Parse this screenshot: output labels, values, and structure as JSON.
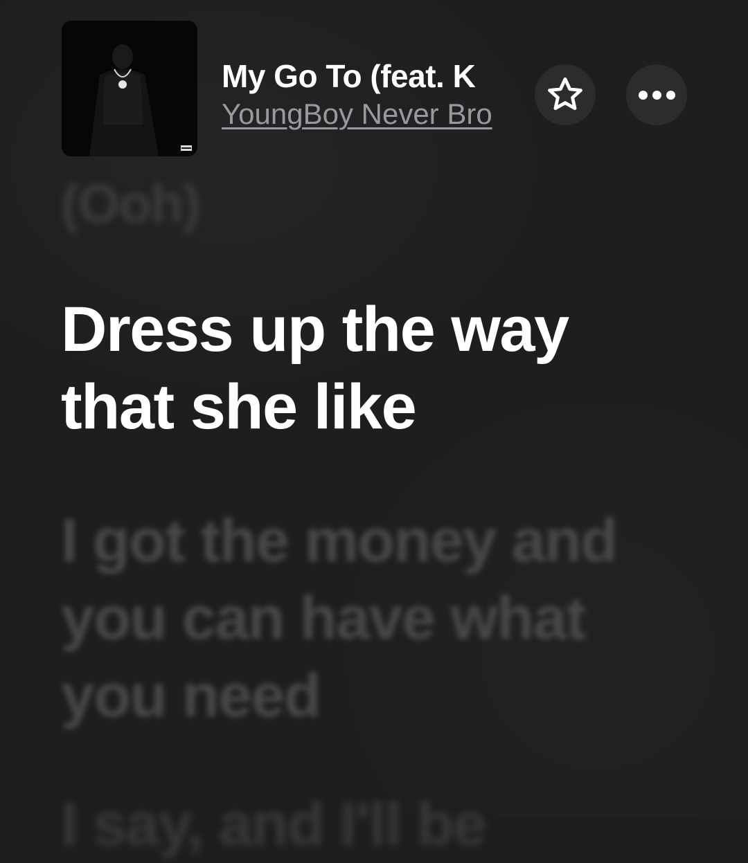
{
  "now_playing": {
    "title": "My Go To (feat. K",
    "artist": "YoungBoy Never Bro"
  },
  "actions": {
    "favorite_icon": "star-outline-icon",
    "more_icon": "ellipsis-icon"
  },
  "lyrics": {
    "previous_line": "(Ooh)",
    "current_line": "Dress up the way that she like",
    "next_line": "I got the money and you can have what you need",
    "following_line": "I say, and I'll be"
  },
  "colors": {
    "background": "#1e1e20",
    "active_lyric": "#ffffff",
    "inactive_lyric": "#48484a",
    "artist_text": "#9a9a9e",
    "button_bg": "#2c2c2f"
  }
}
